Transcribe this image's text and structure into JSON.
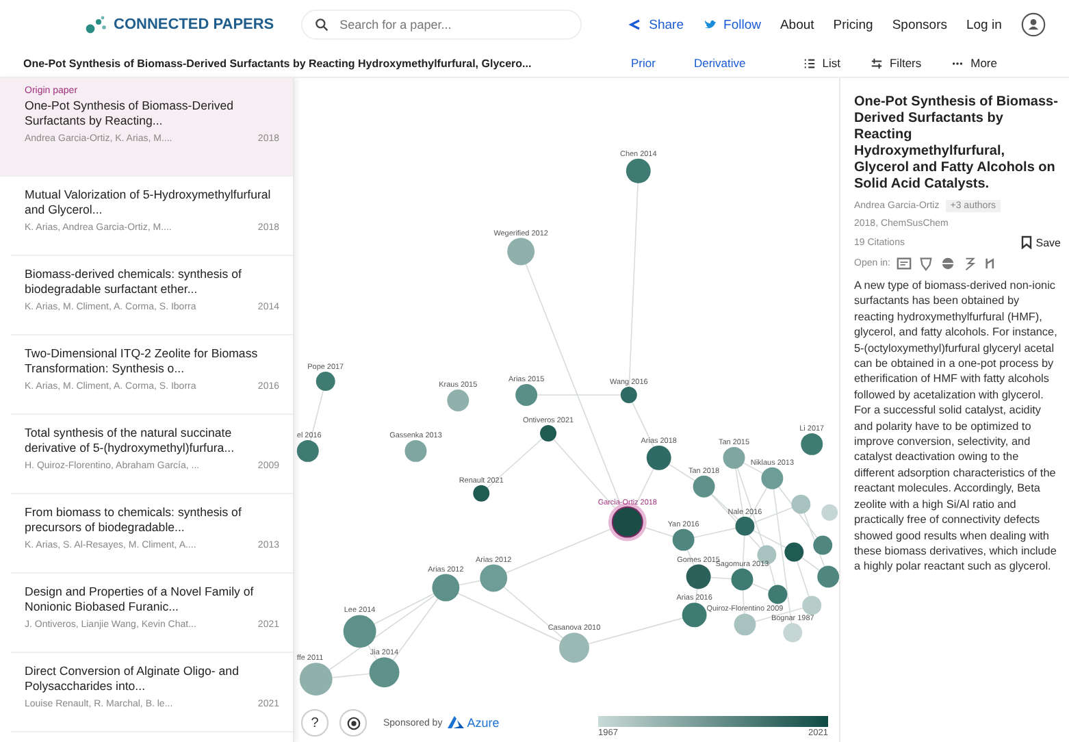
{
  "header": {
    "logo": "CONNECTED PAPERS",
    "search": {
      "placeholder": "Search for a paper..."
    },
    "nav": [
      {
        "label": "Share",
        "kind": "share"
      },
      {
        "label": "Follow",
        "kind": "follow"
      },
      {
        "label": "About",
        "kind": "plain"
      },
      {
        "label": "Pricing",
        "kind": "plain"
      },
      {
        "label": "Sponsors",
        "kind": "plain"
      },
      {
        "label": "Log in",
        "kind": "plain"
      }
    ]
  },
  "toolbar": {
    "title": "One-Pot Synthesis of Biomass-Derived Surfactants by Reacting Hydroxymethylfurfural, Glycero...",
    "links": [
      "Prior",
      "Derivative"
    ],
    "actions": [
      {
        "label": "List",
        "kind": "list"
      },
      {
        "label": "Filters",
        "kind": "filters"
      },
      {
        "label": "More",
        "kind": "more"
      }
    ]
  },
  "papers": [
    {
      "tag": "Origin paper",
      "title": "One-Pot Synthesis of Biomass-Derived Surfactants by Reacting...",
      "authors": "Andrea Garcia-Ortiz, K. Arias, M....",
      "year": "2018",
      "selected": true
    },
    {
      "title": "Mutual Valorization of 5-Hydroxymethylfurfural and Glycerol...",
      "authors": "K. Arias, Andrea Garcia-Ortiz, M....",
      "year": "2018",
      "selected": false
    },
    {
      "title": "Biomass-derived chemicals: synthesis of biodegradable surfactant ether...",
      "authors": "K. Arias, M. Climent, A. Corma, S. Iborra",
      "year": "2014",
      "selected": false
    },
    {
      "title": "Two-Dimensional ITQ-2 Zeolite for Biomass Transformation: Synthesis o...",
      "authors": "K. Arias, M. Climent, A. Corma, S. Iborra",
      "year": "2016",
      "selected": false
    },
    {
      "title": "Total synthesis of the natural succinate derivative of 5-(hydroxymethyl)furfura...",
      "authors": "H. Quiroz-Florentino, Abraham García, ...",
      "year": "2009",
      "selected": false
    },
    {
      "title": "From biomass to chemicals: synthesis of precursors of biodegradable...",
      "authors": "K. Arias, S. Al-Resayes, M. Climent, A....",
      "year": "2013",
      "selected": false
    },
    {
      "title": "Design and Properties of a Novel Family of Nonionic Biobased Furanic...",
      "authors": "J. Ontiveros, Lianjie Wang, Kevin Chat...",
      "year": "2021",
      "selected": false
    },
    {
      "title": "Direct Conversion of Alginate Oligo- and Polysaccharides into...",
      "authors": "Louise Renault, R. Marchal, B. le...",
      "year": "2021",
      "selected": false
    }
  ],
  "graph": {
    "nodes": [
      {
        "label": "Chen 2014",
        "color": "#3f7a73",
        "origin": false
      },
      {
        "label": "Wegerified 2012",
        "color": "#8fb0ab",
        "origin": false
      },
      {
        "label": "Pope 2017",
        "color": "#3f7a73",
        "origin": false
      },
      {
        "label": "Kraus 2015",
        "color": "#8fb0ab",
        "origin": false
      },
      {
        "label": "Arias 2015",
        "color": "#5a8f89",
        "origin": false
      },
      {
        "label": "Ontiveros 2021",
        "color": "#1f5a53",
        "origin": false
      },
      {
        "label": "Gassenka 2013",
        "color": "#7fa6a1",
        "origin": false
      },
      {
        "label": "Renault 2021",
        "color": "#1f5a53",
        "origin": false
      },
      {
        "label": "Arias 2012",
        "color": "#6e9c96",
        "origin": false
      },
      {
        "label": "Arias 2012",
        "color": "#5f918b",
        "origin": false
      },
      {
        "label": "Lee 2014",
        "color": "#5f918b",
        "origin": false
      },
      {
        "label": "Jia 2014",
        "color": "#5f918b",
        "origin": false
      },
      {
        "label": "Casanova 2010",
        "color": "#9ab8b4",
        "origin": false
      },
      {
        "label": "Wang 2016",
        "color": "#2f6b64",
        "origin": false
      },
      {
        "label": "Arias 2018",
        "color": "#2f6b64",
        "origin": false
      },
      {
        "label": "Tan 2015",
        "color": "#7fa6a1",
        "origin": false
      },
      {
        "label": "Li 2017",
        "color": "#3f7a73",
        "origin": false
      },
      {
        "label": "Niklaus 2013",
        "color": "#6e9c96",
        "origin": false
      },
      {
        "label": "Tan 2018",
        "color": "#5f918b",
        "origin": false
      },
      {
        "label": "Garcia-Ortiz 2018",
        "color": "#1b4d47",
        "origin": true
      },
      {
        "label": "Yan 2016",
        "color": "#4f867f",
        "origin": false
      },
      {
        "label": "Nale 2016",
        "color": "#2f6b64",
        "origin": false
      },
      {
        "label": "Gomes 2015",
        "color": "#2b615a",
        "origin": false
      },
      {
        "label": "Sagomura 2013",
        "color": "#3f7a73",
        "origin": false
      },
      {
        "label": "Arias 2016",
        "color": "#3f7a73",
        "origin": false
      },
      {
        "label": "Quiroz-Florentino 2009",
        "color": "#a8c3bf",
        "origin": false
      },
      {
        "label": "Bognar 1987",
        "color": "#c5d6d4",
        "origin": false
      },
      {
        "label": "el 2016",
        "color": "#3f7a73",
        "origin": false
      },
      {
        "label": "ffe 2011",
        "color": "#8fb0ab",
        "origin": false
      }
    ],
    "legend": {
      "min": "1967",
      "max": "2021"
    },
    "help": "?",
    "sponsor": {
      "text": "Sponsored by",
      "brand": "Azure"
    }
  },
  "details": {
    "title": "One-Pot Synthesis of Biomass-Derived Surfactants by Reacting Hydroxymethylfurfural, Glycerol and Fatty Alcohols on Solid Acid Catalysts.",
    "first_author": "Andrea Garcia-Ortiz",
    "more_authors": "+3 authors",
    "venue": "2018, ChemSusChem",
    "citations": "19 Citations",
    "save": "Save",
    "open_in": "Open in:",
    "abstract": "A new type of biomass-derived non-ionic surfactants has been obtained by reacting hydroxymethylfurfural (HMF), glycerol, and fatty alcohols. For instance, 5-(octyloxymethyl)furfural glyceryl acetal can be obtained in a one-pot process by etherification of HMF with fatty alcohols followed by acetalization with glycerol. For a successful solid catalyst, acidity and polarity have to be optimized to improve conversion, selectivity, and catalyst deactivation owing to the different adsorption characteristics of the reactant molecules. Accordingly, Beta zeolite with a high Si/Al ratio and practically free of connectivity defects showed good results when dealing with these biomass derivatives, which include a highly polar reactant such as glycerol."
  }
}
